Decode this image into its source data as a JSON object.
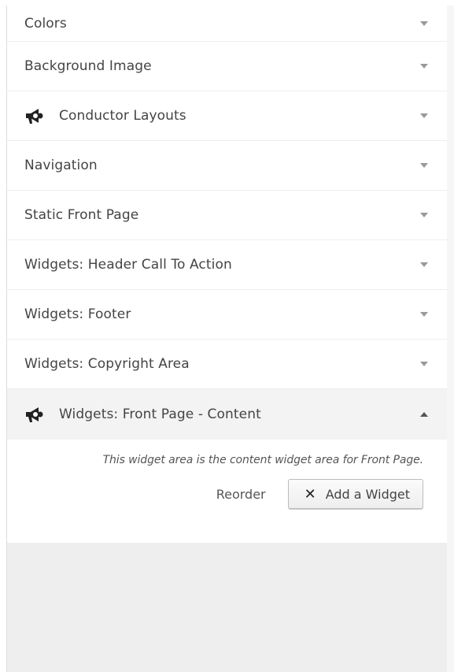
{
  "sections": [
    {
      "label": "Colors",
      "icon": ""
    },
    {
      "label": "Background Image",
      "icon": ""
    },
    {
      "label": "Conductor Layouts",
      "icon": "megaphone-icon"
    },
    {
      "label": "Navigation",
      "icon": ""
    },
    {
      "label": "Static Front Page",
      "icon": ""
    },
    {
      "label": "Widgets: Header Call To Action",
      "icon": ""
    },
    {
      "label": "Widgets: Footer",
      "icon": ""
    },
    {
      "label": "Widgets: Copyright Area",
      "icon": ""
    }
  ],
  "open_section": {
    "label": "Widgets: Front Page - Content",
    "icon": "megaphone-icon",
    "description": "This widget area is the content widget area for Front Page.",
    "reorder_label": "Reorder",
    "add_widget_label": "Add a Widget",
    "add_widget_icon": "close-x-icon"
  },
  "colors": {
    "panel_bg": "#eeeeee",
    "section_bg": "#ffffff",
    "text": "#444444"
  }
}
